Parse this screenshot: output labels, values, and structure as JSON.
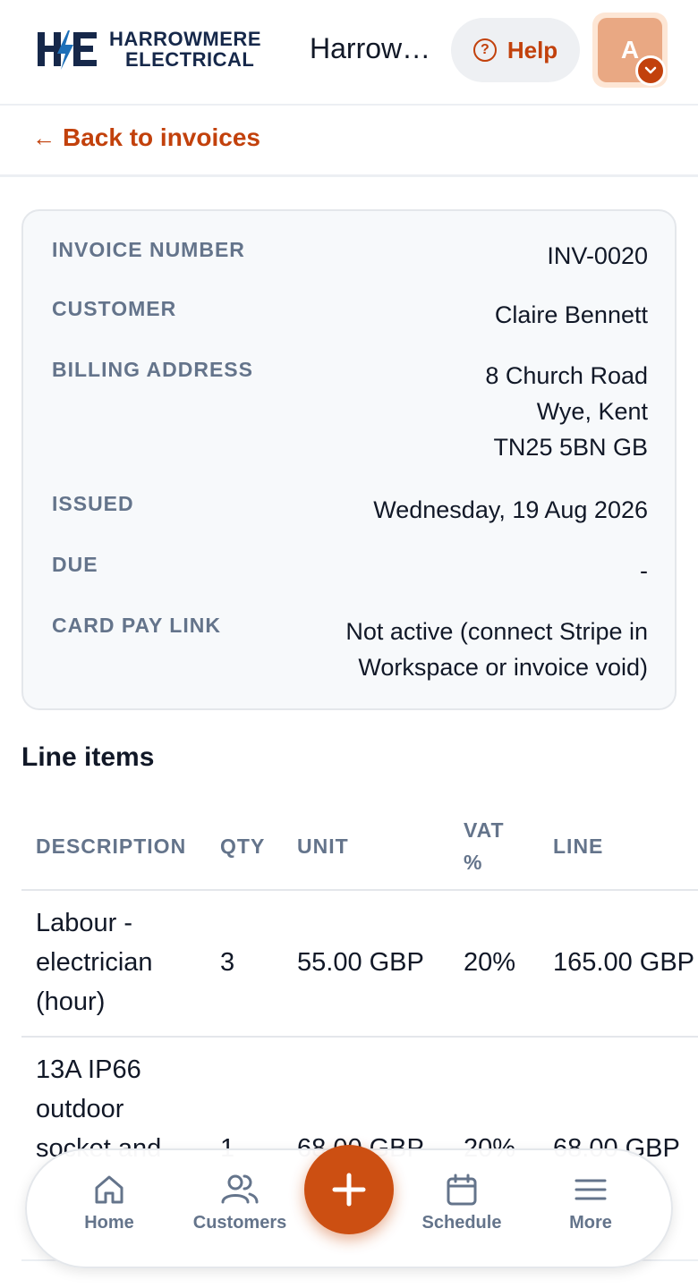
{
  "header": {
    "brand_line1": "HARROWMERE",
    "brand_line2": "ELECTRICAL",
    "workspace_name": "Harrowmere Electrical",
    "help_label": "Help",
    "avatar_initial": "A"
  },
  "back": {
    "arrow": "←",
    "label": "Back to invoices"
  },
  "invoice": {
    "number_label": "INVOICE NUMBER",
    "number": "INV-0020",
    "customer_label": "CUSTOMER",
    "customer": "Claire Bennett",
    "billing_label": "BILLING ADDRESS",
    "billing_lines": [
      "8 Church Road",
      "Wye, Kent",
      "TN25 5BN GB"
    ],
    "issued_label": "ISSUED",
    "issued": "Wednesday, 19 Aug 2026",
    "due_label": "DUE",
    "due": "-",
    "paylink_label": "CARD PAY LINK",
    "paylink_lines": [
      "Not active (connect Stripe in",
      "Workspace or invoice void)"
    ]
  },
  "line_items": {
    "title": "Line items",
    "columns": {
      "description": "DESCRIPTION",
      "qty": "QTY",
      "unit": "UNIT",
      "vat_line1": "VAT",
      "vat_line2": "%",
      "line": "LINE"
    },
    "rows": [
      {
        "description_lines": [
          "Labour -",
          "electrician",
          "(hour)"
        ],
        "qty": "3",
        "unit": "55.00 GBP",
        "vat": "20%",
        "line": "165.00 GBP"
      },
      {
        "description_lines": [
          "13A IP66",
          "outdoor",
          "socket and"
        ],
        "qty": "1",
        "unit": "68.00 GBP",
        "vat": "20%",
        "line": "68.00 GBP"
      }
    ]
  },
  "bottom_nav": {
    "home": "Home",
    "customers": "Customers",
    "schedule": "Schedule",
    "more": "More",
    "fab_symbol": "+"
  },
  "colors": {
    "accent": "#c2410c",
    "fab": "#cc4f12",
    "muted": "#64748b",
    "brand_navy": "#16284a"
  }
}
